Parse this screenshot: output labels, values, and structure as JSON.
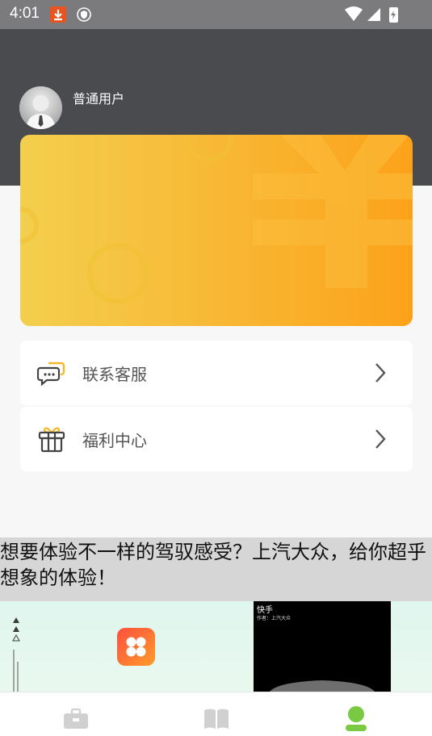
{
  "status_bar": {
    "time": "4:01",
    "icons": [
      "download-icon",
      "shield-icon",
      "wifi-icon",
      "signal-icon",
      "battery-charging-icon"
    ]
  },
  "profile": {
    "user_name": "普通用户",
    "avatar": "default-user-avatar"
  },
  "colors": {
    "header_bg": "#494b4f",
    "card_gradient_start": "#f3cf4e",
    "card_gradient_end": "#fca21a",
    "active_tab": "#7ac943",
    "inactive_tab": "#d0d0d0"
  },
  "menu": [
    {
      "label": "联系客服",
      "icon": "chat-bubbles-icon"
    },
    {
      "label": "福利中心",
      "icon": "gift-icon"
    }
  ],
  "ad": {
    "text": "想要体验不一样的驾驭感受？上汽大众，给你超乎想象的体验！",
    "video_title": "快手",
    "video_subtitle": "作者：上汽大众"
  },
  "tabs": [
    {
      "name": "toolbox",
      "icon": "briefcase-icon",
      "active": false
    },
    {
      "name": "reading",
      "icon": "book-icon",
      "active": false
    },
    {
      "name": "me",
      "icon": "user-icon",
      "active": true
    }
  ]
}
